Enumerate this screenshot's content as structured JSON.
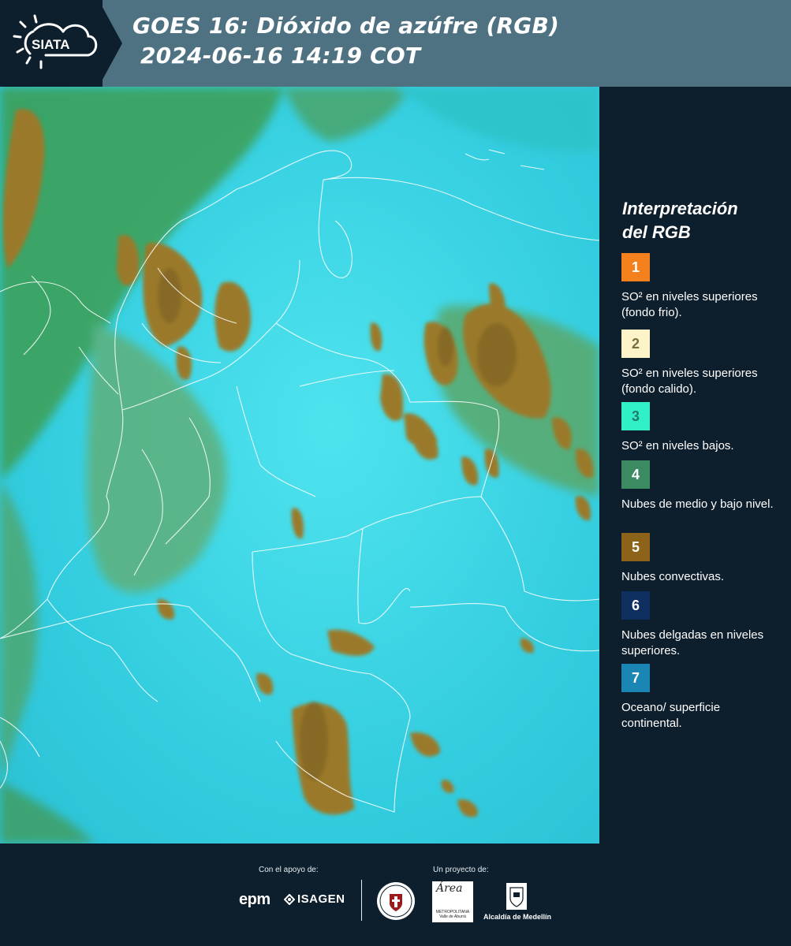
{
  "header": {
    "logo_text": "SIATA",
    "title_line1": "GOES 16: Dióxido de azúfre (RGB)",
    "title_line2": "2024-06-16 14:19 COT"
  },
  "legend": {
    "title_line1": "Interpretación",
    "title_line2": "del RGB",
    "items": [
      {
        "number": "1",
        "color": "#f5801e",
        "text": "SO² en niveles superiores (fondo frio)."
      },
      {
        "number": "2",
        "color": "#fcf4c8",
        "text": "SO² en niveles superiores (fondo calido)."
      },
      {
        "number": "3",
        "color": "#31f0c8",
        "text": "SO² en niveles bajos."
      },
      {
        "number": "4",
        "color": "#3b8a62",
        "text": "Nubes de medio y bajo nivel."
      },
      {
        "number": "5",
        "color": "#8c6318",
        "text": "Nubes convectivas."
      },
      {
        "number": "6",
        "color": "#0f2f60",
        "text": "Nubes delgadas en niveles superiores."
      },
      {
        "number": "7",
        "color": "#1a86b4",
        "text": "Oceano/ superficie continental."
      }
    ]
  },
  "footer": {
    "support_label": "Con el apoyo de:",
    "project_label": "Un proyecto de:",
    "epm": "epm",
    "isagen": "ISAGEN",
    "area_name": "Área",
    "area_sub": "METROPOLITANA Valle de Aburrá",
    "alcaldia": "Alcaldía de Medellín"
  }
}
